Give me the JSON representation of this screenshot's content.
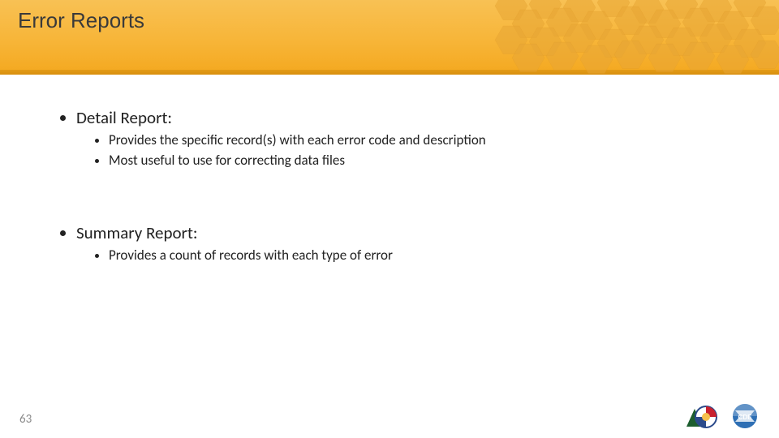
{
  "slide": {
    "title": "Error Reports",
    "page_number": "63",
    "sections": [
      {
        "heading": "Detail Report:",
        "bullets": [
          "Provides the specific record(s) with each error code and description",
          "Most useful to use for correcting data files"
        ]
      },
      {
        "heading": "Summary Report:",
        "bullets": [
          "Provides a count of records with each type of error"
        ]
      }
    ],
    "logos": {
      "left": "Colorado state logo",
      "right": "CDE"
    }
  },
  "colors": {
    "header_grad_top": "#f8c154",
    "header_grad_bottom": "#f4a81f",
    "accent": "#d88f0e"
  }
}
